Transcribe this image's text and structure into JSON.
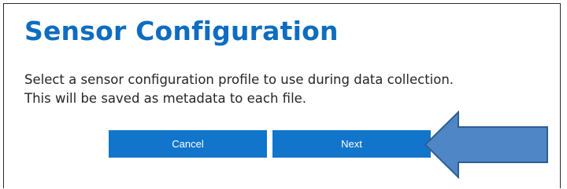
{
  "dialog": {
    "title": "Sensor Configuration",
    "description_line1": "Select a sensor configuration profile to use during data collection.",
    "description_line2": "This will be saved as metadata to each file."
  },
  "buttons": {
    "cancel_label": "Cancel",
    "next_label": "Next"
  },
  "annotation": {
    "icon": "left-arrow-icon",
    "fill_color": "#4f86c6",
    "stroke_color": "#2f5f93"
  },
  "colors": {
    "title": "#0f6cc0",
    "button": "#1275cc",
    "text": "#262626"
  }
}
